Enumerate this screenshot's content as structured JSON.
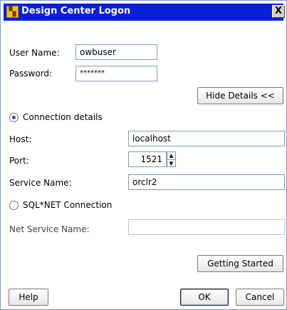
{
  "window": {
    "title": "Design Center Logon",
    "close_glyph": "X",
    "icon": "app-icon"
  },
  "login": {
    "user_label": "User Name:",
    "user_value": "owbuser",
    "password_label": "Password:",
    "password_value": "*******"
  },
  "details_button": "Hide Details <<",
  "connection": {
    "details_option_label": "Connection details",
    "details_selected": true,
    "host_label": "Host:",
    "host_value": "localhost",
    "port_label": "Port:",
    "port_value": "1521",
    "service_label": "Service Name:",
    "service_value": "orclr2",
    "sqlnet_option_label": "SQL*NET Connection",
    "sqlnet_selected": false,
    "net_service_label": "Net Service Name:",
    "net_service_value": ""
  },
  "buttons": {
    "getting_started": "Getting Started",
    "help": "Help",
    "ok": "OK",
    "cancel": "Cancel"
  }
}
